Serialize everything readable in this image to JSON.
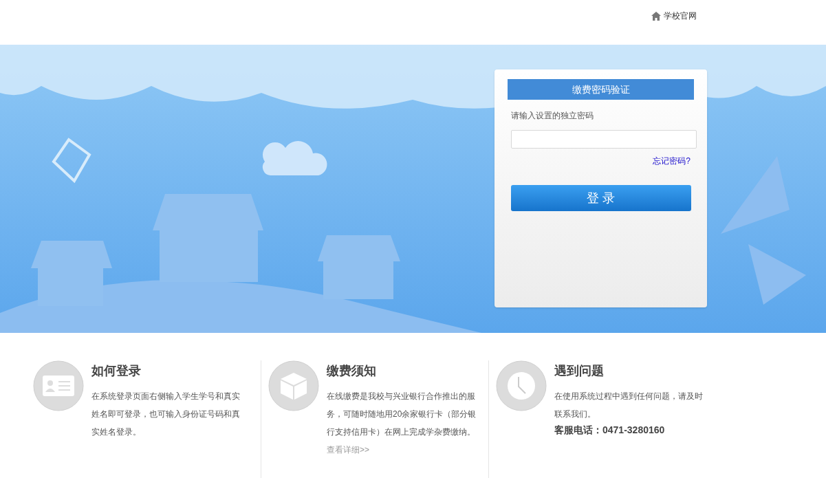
{
  "header": {
    "home_link": "学校官网"
  },
  "login_panel": {
    "title": "缴费密码验证",
    "field_label": "请输入设置的独立密码",
    "forgot_link": "忘记密码?",
    "submit_button": "登 录"
  },
  "info_cards": [
    {
      "title": "如何登录",
      "text": "在系统登录页面右侧输入学生学号和真实姓名即可登录，也可输入身份证号码和真实姓名登录。"
    },
    {
      "title": "缴费须知",
      "text": "在线缴费是我校与兴业银行合作推出的服务，可随时随地用20余家银行卡（部分银行支持信用卡）在网上完成学杂费缴纳。",
      "link": "查看详细>>"
    },
    {
      "title": "遇到问题",
      "text": "在使用系统过程中遇到任何问题，请及时联系我们。",
      "hotline": "客服电话：0471-3280160"
    }
  ]
}
